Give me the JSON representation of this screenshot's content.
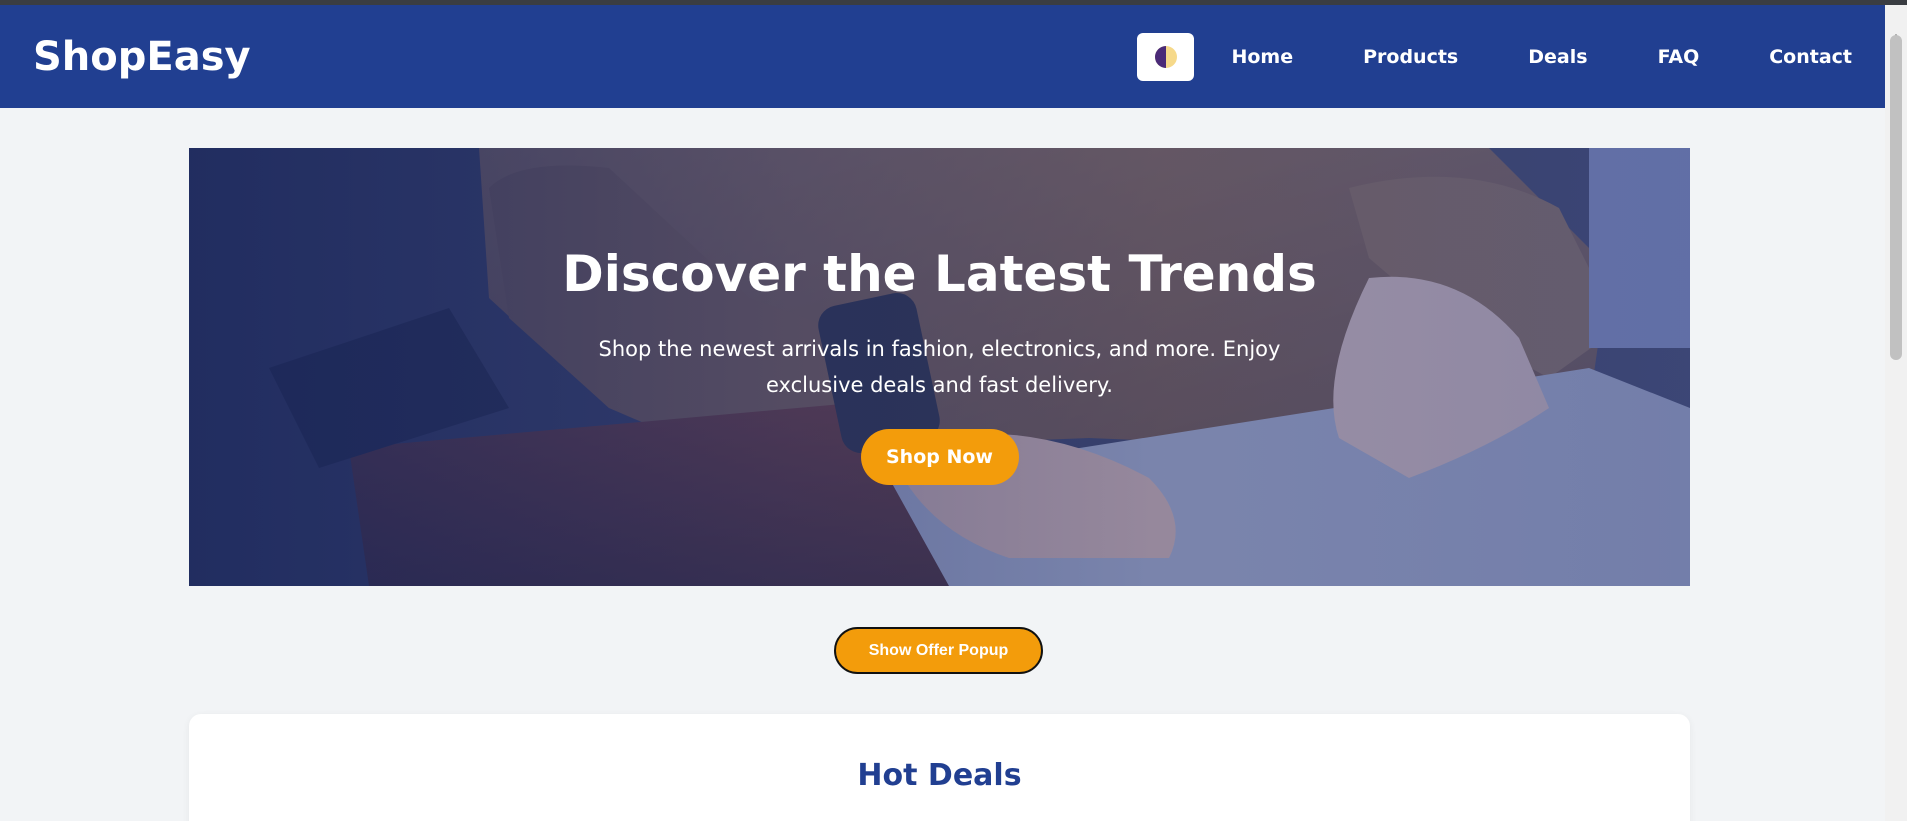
{
  "header": {
    "logo": "ShopEasy",
    "nav": [
      "Home",
      "Products",
      "Deals",
      "FAQ",
      "Contact"
    ]
  },
  "hero": {
    "title": "Discover the Latest Trends",
    "subtitle": "Shop the newest arrivals in fashion, electronics, and more. Enjoy exclusive deals and fast delivery.",
    "cta": "Shop Now"
  },
  "offer_button": "Show Offer Popup",
  "deals": {
    "title": "Hot Deals"
  },
  "colors": {
    "header_bg": "#213f91",
    "accent": "#f39c0b",
    "page_bg": "#f2f4f6",
    "heading": "#213f91"
  },
  "icons": {
    "theme_toggle": "half-moon-theme-icon"
  }
}
